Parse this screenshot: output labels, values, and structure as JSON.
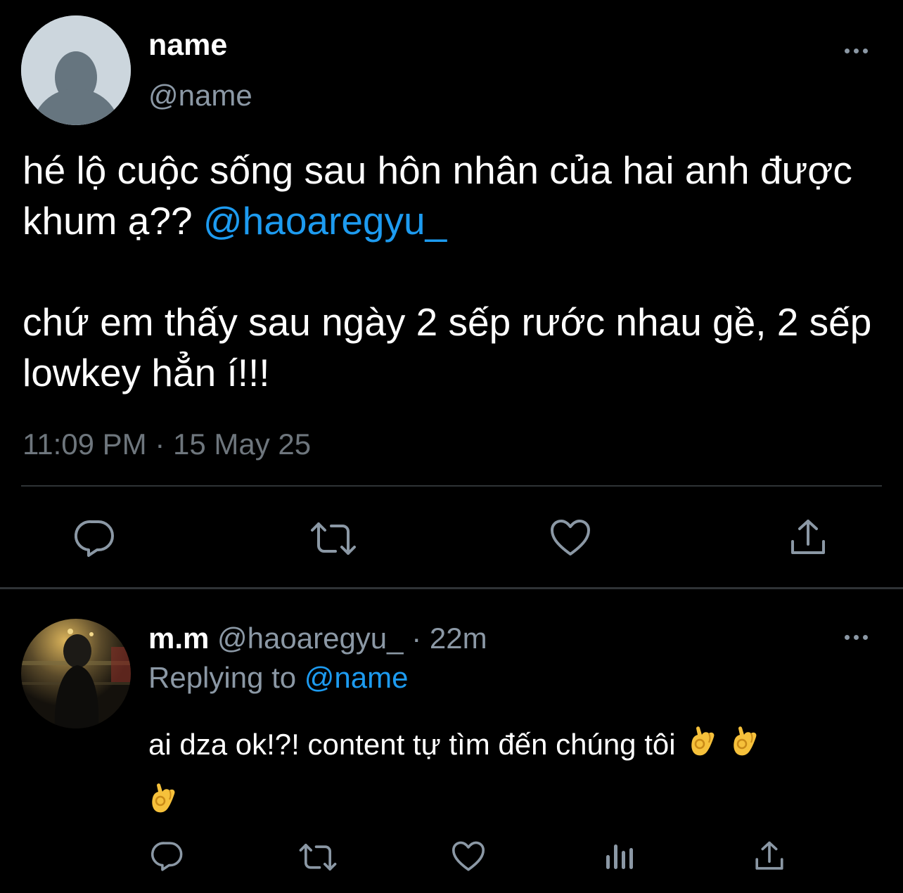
{
  "main_tweet": {
    "author_name": "name",
    "author_handle": "@name",
    "text_line1": "hé lộ cuộc sống sau hôn nhân của hai anh được khum ạ?? ",
    "mention": "@haoaregyu_",
    "text_para2": "chứ em thấy sau ngày 2 sếp rước nhau gề, 2 sếp lowkey hẳn í!!!",
    "timestamp": "11:09 PM · 15 May 25"
  },
  "reply_tweet": {
    "author_name": "m.m",
    "author_handle": "@haoaregyu_",
    "separator": " · ",
    "time": "22m",
    "replying_prefix": "Replying to ",
    "replying_mention": "@name",
    "text": "ai dza ok!?! content tự tìm đến chúng tôi",
    "emoji": "ok-hand-emoji"
  },
  "icons": {
    "reply": "reply-icon",
    "retweet": "retweet-icon",
    "like": "heart-icon",
    "share": "share-icon",
    "analytics": "analytics-icon",
    "more": "more-icon"
  },
  "colors": {
    "background": "#000000",
    "text": "#ffffff",
    "secondary": "#8b98a5",
    "accent": "#1d9bf0",
    "divider": "#2f3336"
  }
}
